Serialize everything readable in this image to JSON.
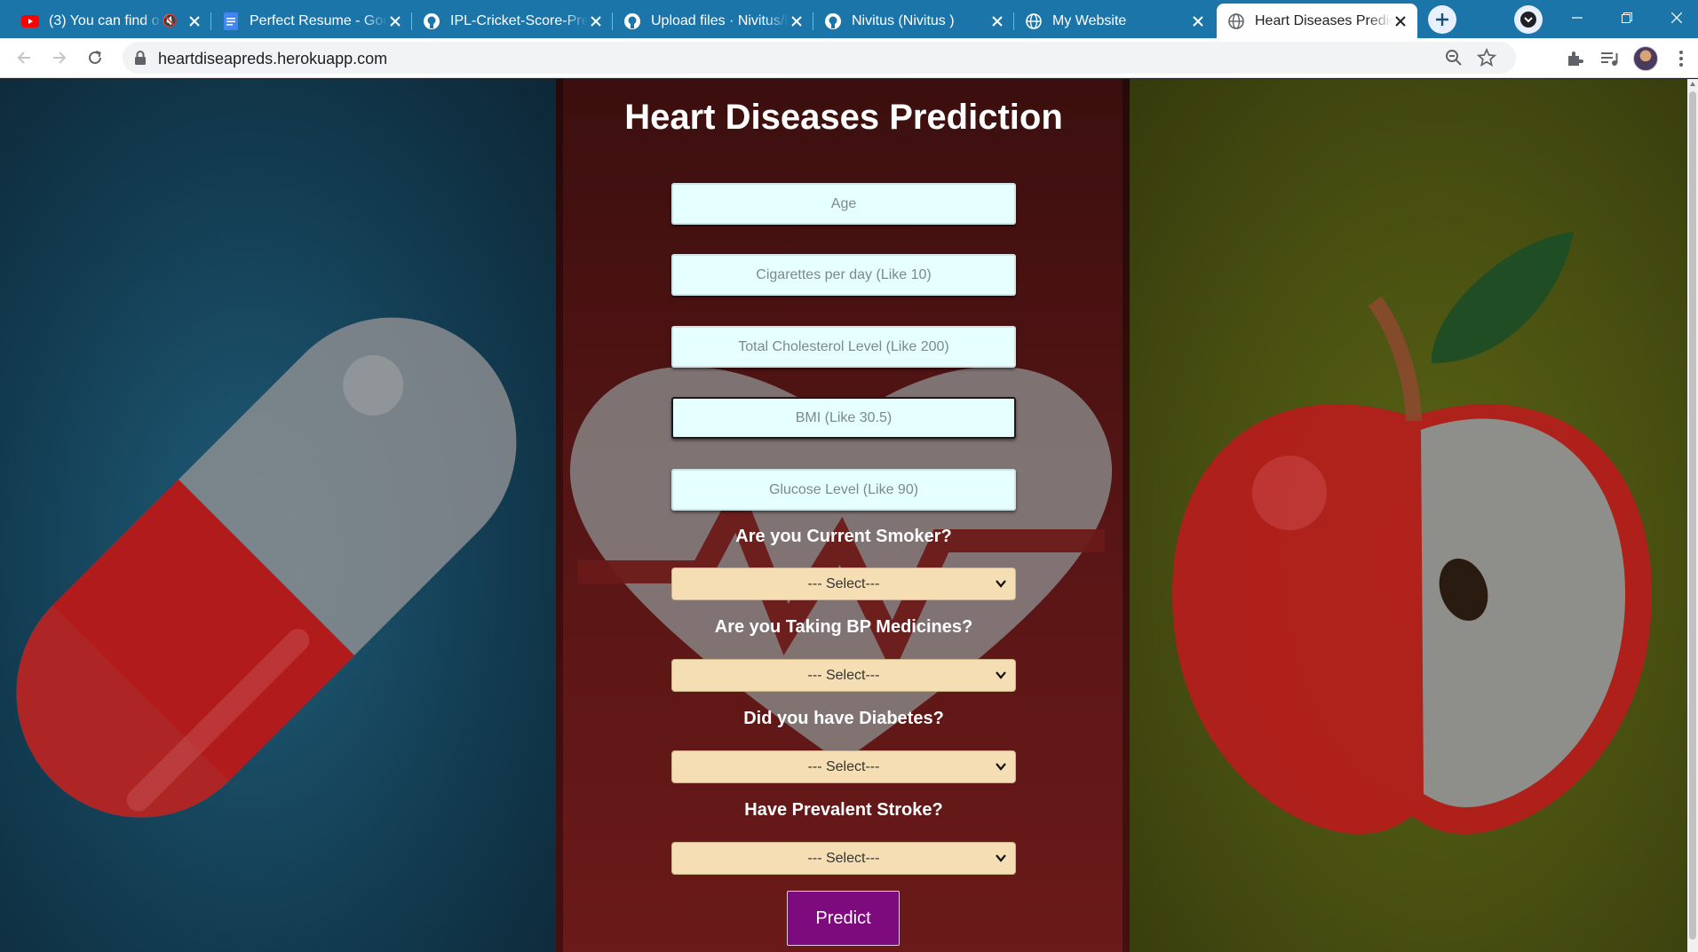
{
  "browser": {
    "tabs": [
      {
        "title": "(3) You can find o",
        "icon": "youtube-icon",
        "muted": true
      },
      {
        "title": "Perfect Resume - Goo",
        "icon": "google-docs-icon"
      },
      {
        "title": "IPL-Cricket-Score-Pre",
        "icon": "github-icon"
      },
      {
        "title": "Upload files · Nivitus/I",
        "icon": "github-icon"
      },
      {
        "title": "Nivitus (Nivitus )",
        "icon": "github-icon"
      },
      {
        "title": "My Website",
        "icon": "globe-icon"
      },
      {
        "title": "Heart Diseases Predict",
        "icon": "globe-icon",
        "active": true
      }
    ],
    "url": "heartdiseapreds.herokuapp.com",
    "colors": {
      "frame": "#1b75a8",
      "toolbar": "#ffffff"
    }
  },
  "page": {
    "heading": "Heart Diseases Prediction",
    "fields": {
      "age": {
        "placeholder": "Age",
        "value": ""
      },
      "cigs": {
        "placeholder": "Cigarettes per day (Like 10)",
        "value": ""
      },
      "chol": {
        "placeholder": "Total Cholesterol Level (Like 200)",
        "value": ""
      },
      "bmi": {
        "placeholder": "BMI (Like 30.5)",
        "value": ""
      },
      "glucose": {
        "placeholder": "Glucose Level (Like 90)",
        "value": ""
      }
    },
    "questions": {
      "smoker": {
        "label": "Are you Current Smoker?",
        "selected": "--- Select---"
      },
      "bp": {
        "label": "Are you Taking BP Medicines?",
        "selected": "--- Select---"
      },
      "diabetes": {
        "label": "Did you have Diabetes?",
        "selected": "--- Select---"
      },
      "stroke": {
        "label": "Have Prevalent Stroke?",
        "selected": "--- Select---"
      }
    },
    "predict_label": "Predict",
    "colors": {
      "field_bg": "#e6ffff",
      "select_bg": "#f5deb3",
      "button_bg": "#7d0b7d"
    }
  }
}
